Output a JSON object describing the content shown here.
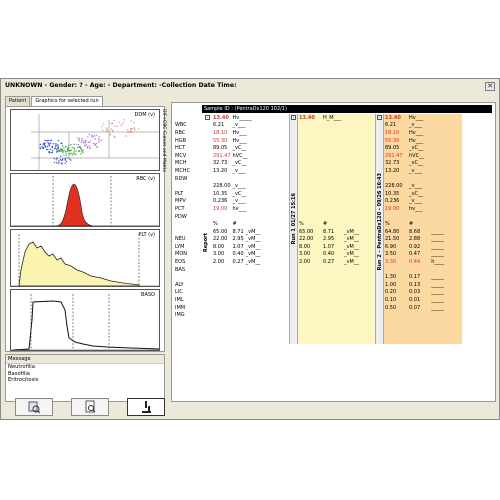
{
  "window": {
    "title": "UNKNOWN - Gender: ? - Age:    - Department:    -Collection Date Time:",
    "close_glyph": "✕"
  },
  "tabs": [
    {
      "label": "Patient"
    },
    {
      "label": "Graphics for selected run"
    }
  ],
  "side_strip_label": "DIF+CBC Curves and Matrix",
  "graphs": {
    "ddm": "DDM (v)",
    "rbc": "RBC (v)",
    "plt": "PLT (v)",
    "baso": "BASO"
  },
  "message": {
    "title": "Message",
    "lines": [
      "Neutrofilia",
      "Basofilia",
      "Eritrocitosis"
    ]
  },
  "sample_header": "Sample ID : (PentraDx120 102/1)",
  "report_label": "Report",
  "run1_label": "Run 1 01/27 15:16",
  "run2_label": "Run 2 - PentraDx120 - 09/26 16:43",
  "header_row": {
    "c1_value": "13.40",
    "c1_flag": "Hv_____",
    "c2_value": "13.40",
    "c2_flag": "H_M___",
    "c3_value": "13.40",
    "c3_flag": "Hv___"
  },
  "cbc": [
    {
      "name": "WBC",
      "v": "",
      "f": "",
      "red": false
    },
    {
      "name": "RBC",
      "v": "6.21",
      "f": "_v___",
      "red": false
    },
    {
      "name": "HGB",
      "v": "18.10",
      "f": "Hv___",
      "red": true
    },
    {
      "name": "HCT",
      "v": "55.30",
      "f": "Hv___",
      "red": true
    },
    {
      "name": "MCV",
      "v": "89.05",
      "f": "_vC__",
      "red": false
    },
    {
      "name": "MCH",
      "v": "291.47",
      "f": "hVC__",
      "red": true
    },
    {
      "name": "MCHC",
      "v": "32.73",
      "f": "_vC__",
      "red": false
    },
    {
      "name": "RDW",
      "v": "13.20",
      "f": "_v___",
      "red": false
    }
  ],
  "cbc_run2": [
    {
      "v": "6.21",
      "f": "_v___",
      "red": false
    },
    {
      "v": "18.10",
      "f": "Hv___",
      "red": true
    },
    {
      "v": "55.30",
      "f": "Hv___",
      "red": true
    },
    {
      "v": "89.05",
      "f": "_vC__",
      "red": false
    },
    {
      "v": "291.47",
      "f": "hVC__",
      "red": true
    },
    {
      "v": "32.73",
      "f": "_vC__",
      "red": false
    },
    {
      "v": "13.20",
      "f": "_v___",
      "red": false
    }
  ],
  "plt_rows": [
    {
      "name": "PLT",
      "v": "228.00",
      "f": "_v___",
      "red": false
    },
    {
      "name": "MPV",
      "v": "10.35",
      "f": "_vC__",
      "red": false
    },
    {
      "name": "PCT",
      "v": "0.236",
      "f": "_v___",
      "red": false
    },
    {
      "name": "PDW",
      "v": "19.00",
      "f": "hv___",
      "red": true
    }
  ],
  "diff_head": {
    "pct": "%",
    "abs": "#"
  },
  "diff_rows": [
    {
      "name": "NEU",
      "p": "65.00",
      "a": "8.71",
      "f": "_vM__"
    },
    {
      "name": "LYM",
      "p": "22.00",
      "a": "2.95",
      "f": "_vM__"
    },
    {
      "name": "MON",
      "p": "8.00",
      "a": "1.07",
      "f": "_vM__"
    },
    {
      "name": "EOS",
      "p": "3.00",
      "a": "0.40",
      "f": "_vM__"
    },
    {
      "name": "BAS",
      "p": "2.00",
      "a": "0.27",
      "f": "_vM__"
    }
  ],
  "diff_run2": [
    {
      "p": "64.80",
      "a": "8.68",
      "f": "_____",
      "red": false
    },
    {
      "p": "21.50",
      "a": "2.88",
      "f": "_____",
      "red": false
    },
    {
      "p": "6.90",
      "a": "0.92",
      "f": "_____",
      "red": false
    },
    {
      "p": "3.50",
      "a": "0.47",
      "f": "_____",
      "red": false
    },
    {
      "p": "3.30",
      "a": "0.44",
      "f": "h____",
      "red": true
    }
  ],
  "ext_rows": [
    {
      "name": "ALY"
    },
    {
      "name": "LIC"
    },
    {
      "name": "IML"
    },
    {
      "name": "IMM"
    },
    {
      "name": "IMG"
    }
  ],
  "ext_run2": [
    {
      "p": "1.30",
      "a": "0.17",
      "f": "_____"
    },
    {
      "p": "1.00",
      "a": "0.13",
      "f": "_____"
    },
    {
      "p": "0.20",
      "a": "0.03",
      "f": "_____"
    },
    {
      "p": "0.10",
      "a": "0.01",
      "f": "_____"
    },
    {
      "p": "0.50",
      "a": "0.07",
      "f": "_____"
    }
  ],
  "colors": {
    "report_fill": "#ffffff",
    "run1_fill": "#fdf6c0",
    "run2_fill": "#fcd9a0",
    "rbc_peak": "#e03020",
    "plt_fill": "#fbf3b0"
  }
}
